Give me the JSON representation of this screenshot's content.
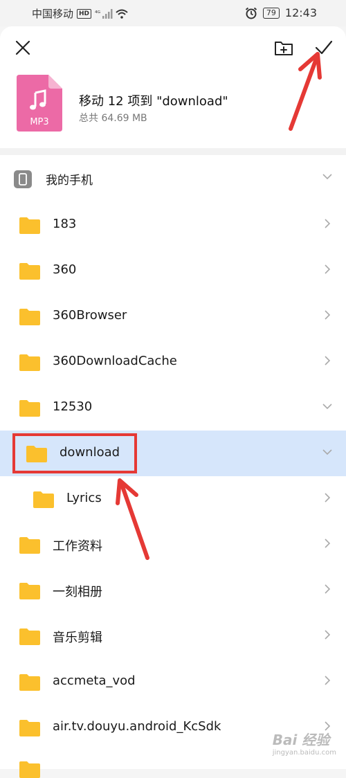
{
  "status_bar": {
    "carrier": "中国移动",
    "hd_badge": "HD",
    "signal_label": "⁴ᴳ",
    "battery": "79",
    "time": "12:43"
  },
  "header": {
    "move_title": "移动 12 项到 \"download\"",
    "total_size": "总共 64.69 MB",
    "file_type_label": "MP3"
  },
  "folders": {
    "root": "我的手机",
    "items": [
      {
        "label": "183"
      },
      {
        "label": "360"
      },
      {
        "label": "360Browser"
      },
      {
        "label": "360DownloadCache"
      },
      {
        "label": "12530"
      },
      {
        "label": "download"
      },
      {
        "label": "Lyrics"
      },
      {
        "label": "工作资料"
      },
      {
        "label": "一刻相册"
      },
      {
        "label": "音乐剪辑"
      },
      {
        "label": "accmeta_vod"
      },
      {
        "label": "air.tv.douyu.android_KcSdk"
      }
    ]
  },
  "watermark": {
    "main": "Bai 经验",
    "sub": "jingyan.baidu.com"
  },
  "colors": {
    "accent": "#e53935",
    "selected_row": "#d6e6fb",
    "folder": "#fbc02d",
    "file_icon": "#ec6aa6"
  }
}
